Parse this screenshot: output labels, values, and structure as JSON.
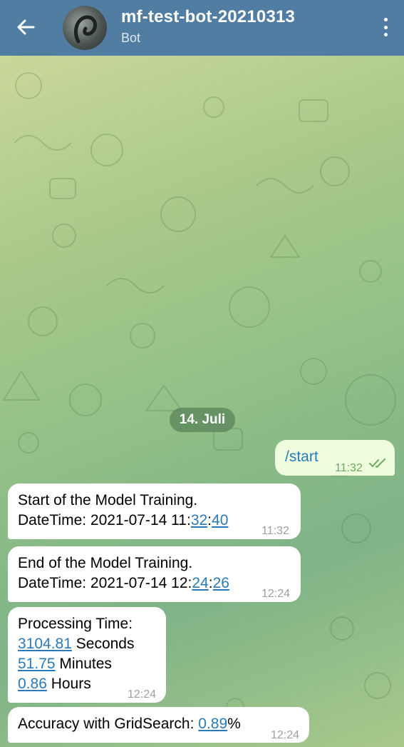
{
  "header": {
    "title": "mf-test-bot-20210313",
    "subtitle": "Bot"
  },
  "date_separator": "14. Juli",
  "messages": {
    "m1": {
      "text": "/start",
      "time": "11:32"
    },
    "m2": {
      "line1": "Start of the Model Training.",
      "prefix": "DateTime: 2021-07-14 11:",
      "min": "32",
      "sep": ":",
      "sec": "40",
      "time": "11:32"
    },
    "m3": {
      "line1": "End of the Model Training.",
      "prefix": "DateTime: 2021-07-14 12:",
      "min": "24",
      "sep": ":",
      "sec": "26",
      "time": "12:24"
    },
    "m4": {
      "line1": "Processing Time:",
      "v1": "3104.81",
      "u1": " Seconds",
      "v2": "51.75",
      "u2": " Minutes",
      "v3": "0.86",
      "u3": " Hours",
      "time": "12:24"
    },
    "m5": {
      "prefix": "Accuracy with GridSearch: ",
      "value": "0.89",
      "suffix": "%",
      "time": "12:24"
    }
  },
  "colors": {
    "header": "#517da2",
    "outgoing_bubble": "#effdde",
    "link": "#2a7ab7"
  },
  "icons": {
    "back": "arrow-left-icon",
    "menu": "more-vertical-icon",
    "read": "double-check-icon"
  }
}
